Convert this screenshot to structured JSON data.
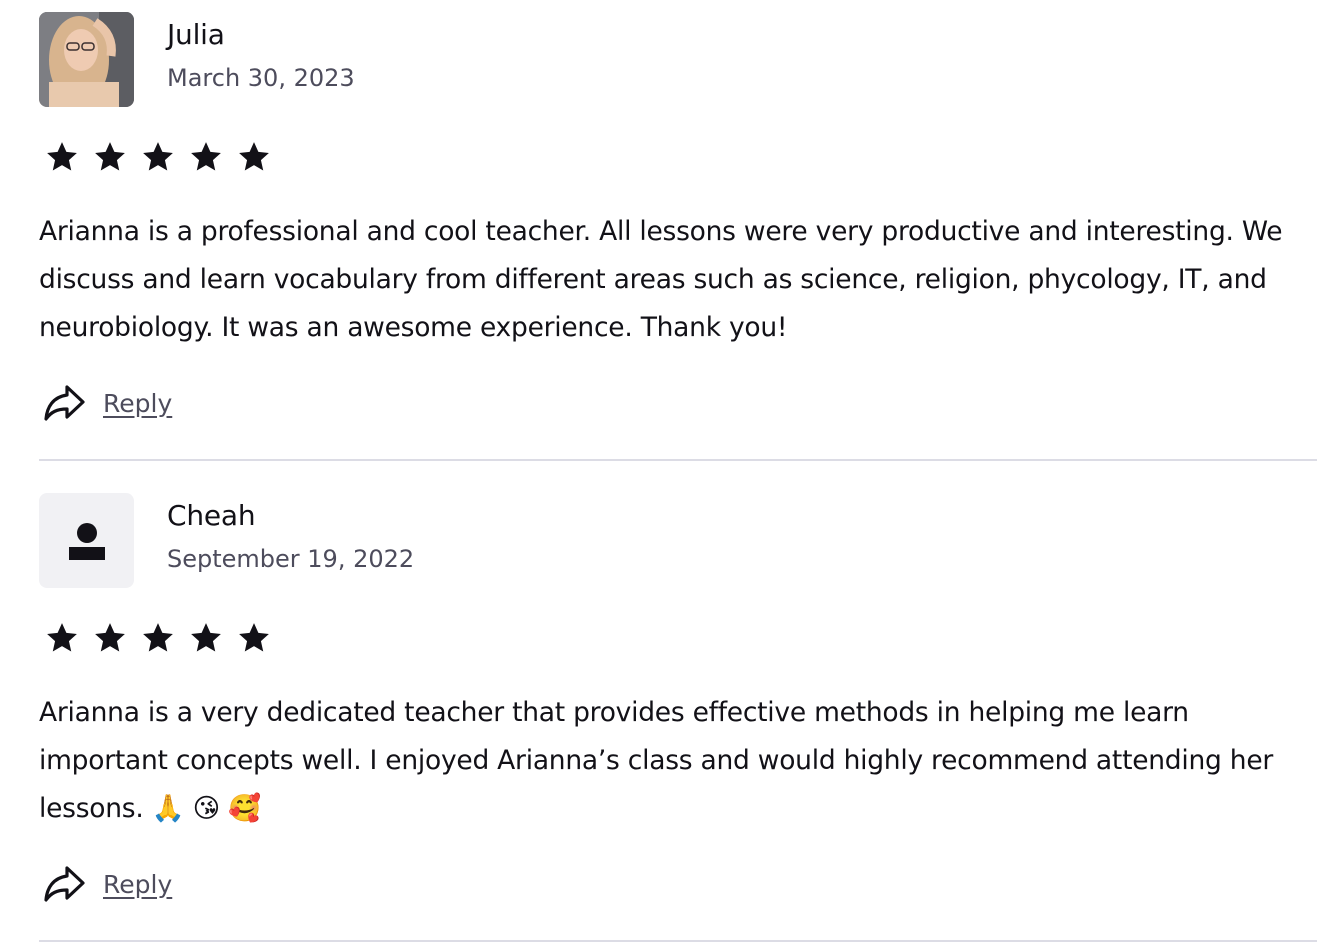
{
  "reviews": [
    {
      "name": "Julia",
      "date": "March 30, 2023",
      "rating": 5,
      "avatar": "photo",
      "text": "Arianna is a professional and cool teacher. All lessons were very productive and interesting. We discuss and learn vocabulary from different areas such as science, religion, phycology, IT, and neurobiology. It was an awesome experience. Thank you!",
      "reply_label": "Reply"
    },
    {
      "name": "Cheah",
      "date": "September 19, 2022",
      "rating": 5,
      "avatar": "placeholder-user-icon",
      "text": "Arianna is a very dedicated teacher that provides effective methods in helping me learn important concepts well. I enjoyed Arianna’s class and would highly recommend attending her lessons. 🙏 😘 🥰",
      "reply_label": "Reply"
    }
  ],
  "icons": {
    "star": "star-icon",
    "reply": "reply-arrow-icon"
  },
  "colors": {
    "text": "#121117",
    "muted": "#4d4c5c",
    "divider": "#dcdce5",
    "avatar_placeholder_bg": "#f1f1f4"
  }
}
